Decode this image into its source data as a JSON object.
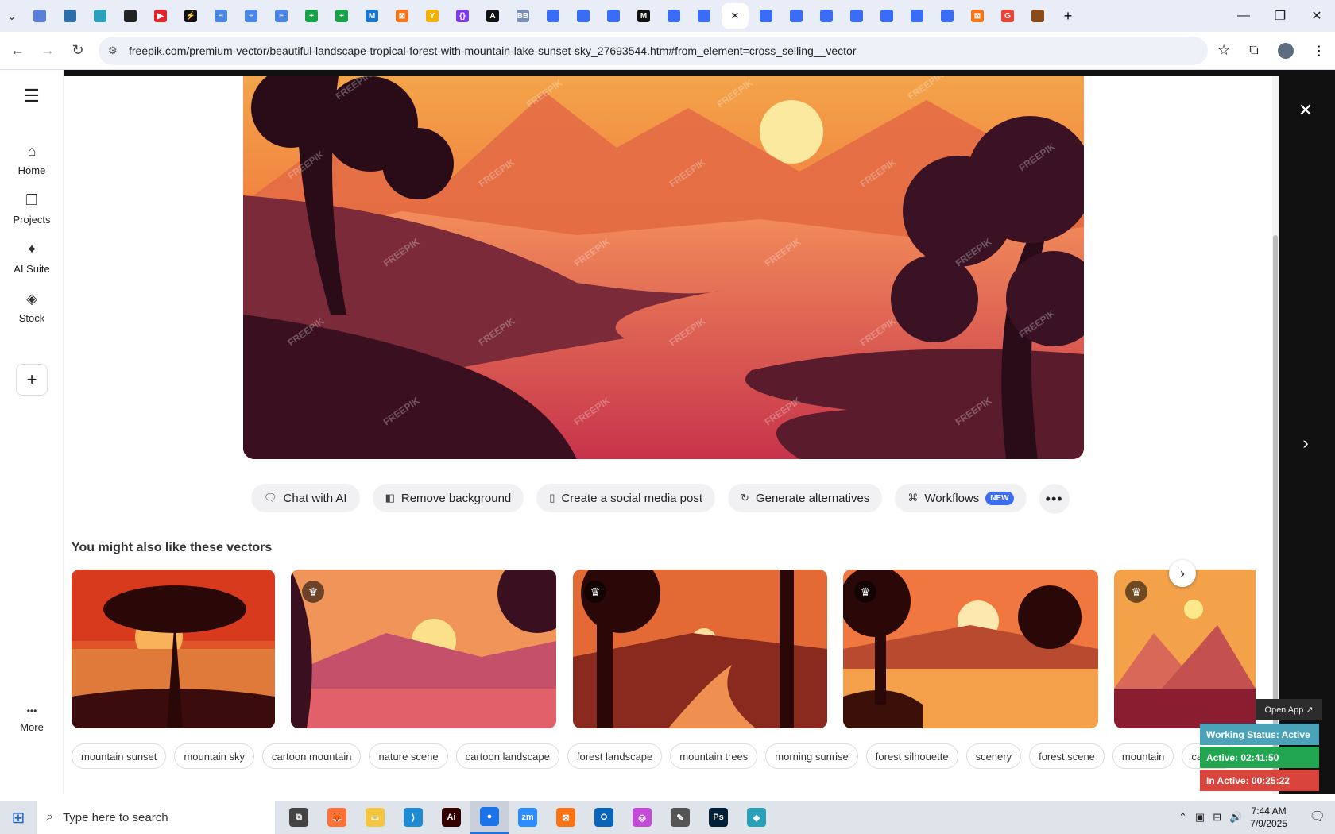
{
  "browser": {
    "url": "freepik.com/premium-vector/beautiful-landscape-tropical-forest-with-mountain-lake-sunset-sky_27693544.htm#from_element=cross_selling__vector",
    "tabs": [
      {
        "color": "#5b7fd6",
        "glyph": ""
      },
      {
        "color": "#2d6ea8",
        "glyph": ""
      },
      {
        "color": "#2aa1b8",
        "glyph": ""
      },
      {
        "color": "#222",
        "glyph": ""
      },
      {
        "color": "#e0242b",
        "glyph": "▶"
      },
      {
        "color": "#111",
        "glyph": "⚡"
      },
      {
        "color": "#4a86e8",
        "glyph": "≡"
      },
      {
        "color": "#4a86e8",
        "glyph": "≡"
      },
      {
        "color": "#4a86e8",
        "glyph": "≡"
      },
      {
        "color": "#16a34a",
        "glyph": "+"
      },
      {
        "color": "#16a34a",
        "glyph": "+"
      },
      {
        "color": "#1976d2",
        "glyph": "M"
      },
      {
        "color": "#f97316",
        "glyph": "⊠"
      },
      {
        "color": "#f5b100",
        "glyph": "Y"
      },
      {
        "color": "#7c3aed",
        "glyph": "{}"
      },
      {
        "color": "#111",
        "glyph": "A"
      },
      {
        "color": "#7a8fb8",
        "glyph": "BB"
      },
      {
        "color": "#3b6cf5",
        "glyph": ""
      },
      {
        "color": "#3b6cf5",
        "glyph": ""
      },
      {
        "color": "#3b6cf5",
        "glyph": ""
      },
      {
        "color": "#111",
        "glyph": "M"
      },
      {
        "color": "#3b6cf5",
        "glyph": ""
      },
      {
        "color": "#3b6cf5",
        "glyph": ""
      }
    ],
    "tabs_after": [
      {
        "color": "#3b6cf5",
        "glyph": ""
      },
      {
        "color": "#3b6cf5",
        "glyph": ""
      },
      {
        "color": "#3b6cf5",
        "glyph": ""
      },
      {
        "color": "#3b6cf5",
        "glyph": ""
      },
      {
        "color": "#3b6cf5",
        "glyph": ""
      },
      {
        "color": "#3b6cf5",
        "glyph": ""
      },
      {
        "color": "#3b6cf5",
        "glyph": ""
      },
      {
        "color": "#f97316",
        "glyph": "⊠"
      },
      {
        "color": "#ea4335",
        "glyph": "G"
      },
      {
        "color": "#8a4a1a",
        "glyph": ""
      }
    ]
  },
  "leftnav": {
    "items": [
      {
        "label": "Home",
        "icon": "home-icon",
        "glyph": "⌂"
      },
      {
        "label": "Projects",
        "icon": "projects-icon",
        "glyph": "❐"
      },
      {
        "label": "AI Suite",
        "icon": "ai-suite-icon",
        "glyph": "✦"
      },
      {
        "label": "Stock",
        "icon": "stock-icon",
        "glyph": "◈"
      }
    ],
    "add_glyph": "+",
    "more_label": "More",
    "more_glyph": "•••",
    "menu_glyph": "☰"
  },
  "actions": {
    "chat": "Chat with AI",
    "remove_bg": "Remove background",
    "social": "Create a social media post",
    "alternatives": "Generate alternatives",
    "workflows": "Workflows",
    "workflows_badge": "NEW"
  },
  "related": {
    "title": "You might also like these vectors"
  },
  "tags": [
    "mountain sunset",
    "mountain sky",
    "cartoon mountain",
    "nature scene",
    "cartoon landscape",
    "forest landscape",
    "mountain trees",
    "morning sunrise",
    "forest silhouette",
    "scenery",
    "forest scene",
    "mountain",
    "cartoon"
  ],
  "watermark": "FREEPIK",
  "work_status": {
    "open_app": "Open App ↗",
    "status": "Working Status: Active",
    "active": "Active: 02:41:50",
    "inactive": "In Active: 00:25:22",
    "status_color": "#4aa3b8",
    "active_color": "#22a652",
    "inactive_color": "#d9443c"
  },
  "taskbar": {
    "search_placeholder": "Type here to search",
    "time": "7:44 AM",
    "date": "7/9/2025",
    "apps": [
      {
        "name": "task-view-icon",
        "color": "#444",
        "glyph": "⧉"
      },
      {
        "name": "firefox-icon",
        "color": "#ff7139",
        "glyph": "🦊"
      },
      {
        "name": "file-explorer-icon",
        "color": "#f4c542",
        "glyph": "▭"
      },
      {
        "name": "vscode-icon",
        "color": "#1f8ad2",
        "glyph": "⟩"
      },
      {
        "name": "illustrator-icon",
        "color": "#330000",
        "glyph": "Ai"
      },
      {
        "name": "chrome-icon",
        "color": "#1a73e8",
        "glyph": "●"
      },
      {
        "name": "zoom-icon",
        "color": "#2d8cff",
        "glyph": "zm"
      },
      {
        "name": "xampp-icon",
        "color": "#f97316",
        "glyph": "⊠"
      },
      {
        "name": "outlook-icon",
        "color": "#0a64b8",
        "glyph": "O"
      },
      {
        "name": "photos-icon",
        "color": "#c34ad6",
        "glyph": "◎"
      },
      {
        "name": "pen-tool-icon",
        "color": "#555",
        "glyph": "✎"
      },
      {
        "name": "photoshop-icon",
        "color": "#001e36",
        "glyph": "Ps"
      },
      {
        "name": "app-icon",
        "color": "#2aa1b8",
        "glyph": "◆"
      }
    ]
  }
}
